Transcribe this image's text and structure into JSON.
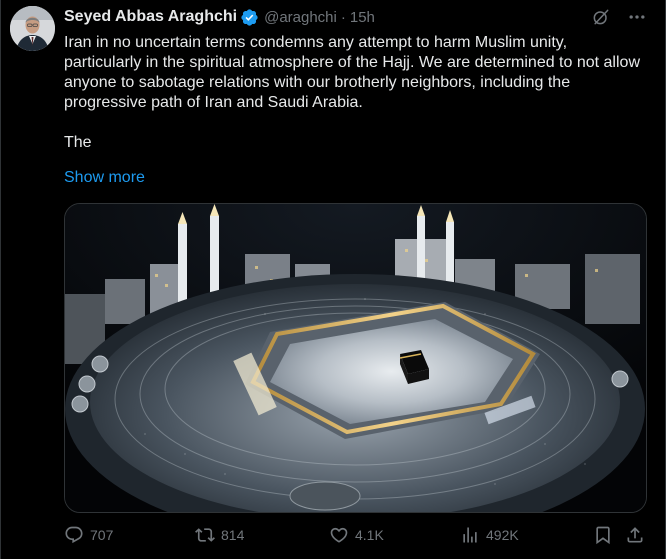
{
  "author": {
    "display_name": "Seyed Abbas Araghchi",
    "handle": "@araghchi",
    "separator": "·",
    "time": "15h",
    "verified": true
  },
  "icons": {
    "verified": "verified-badge-icon",
    "grok": "grok-icon",
    "more": "more-options-icon",
    "reply": "reply-icon",
    "retweet": "retweet-icon",
    "like": "like-icon",
    "views": "views-icon",
    "bookmark": "bookmark-icon",
    "share": "share-icon"
  },
  "tweet": {
    "paragraph_1": "Iran in no uncertain terms condemns any attempt to harm Muslim unity, particularly in the spiritual atmosphere of the Hajj. We are determined to not allow anyone to sabotage relations with our brotherly neighbors, including the progressive path of Iran and Saudi Arabia.",
    "paragraph_2": "The",
    "show_more": "Show more"
  },
  "actions": {
    "replies": "707",
    "retweets": "814",
    "likes": "4.1K",
    "views": "492K"
  },
  "colors": {
    "background": "#000000",
    "text": "#e7e9ea",
    "muted": "#71767b",
    "link": "#1d9bf0",
    "verified": "#1d9bf0",
    "border": "#2f3336"
  }
}
